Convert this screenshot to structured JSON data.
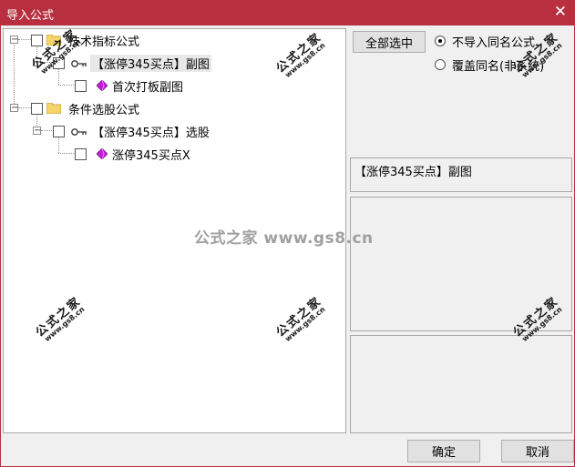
{
  "window": {
    "title": "导入公式"
  },
  "tree": {
    "nodes": [
      {
        "label": "技术指标公式",
        "icon": "folder-icon"
      },
      {
        "label": "【涨停345买点】副图",
        "icon": "key-icon"
      },
      {
        "label": "首次打板副图",
        "icon": "gem-icon"
      },
      {
        "label": "条件选股公式",
        "icon": "folder-icon"
      },
      {
        "label": "【涨停345买点】选股",
        "icon": "key-icon"
      },
      {
        "label": "涨停345买点X",
        "icon": "gem-icon"
      }
    ]
  },
  "actions": {
    "select_all": "全部选中"
  },
  "options": {
    "no_import_same_name": "不导入同名公式",
    "overwrite_same_name": "覆盖同名(非系统)",
    "selected": "no_import_same_name"
  },
  "preview": {
    "text": "【涨停345买点】副图"
  },
  "footer": {
    "ok": "确定",
    "cancel": "取消"
  },
  "watermark": {
    "cn": "公式之家",
    "url": "www.gs8.cn",
    "center": "公式之家 www.gs8.cn"
  },
  "colors": {
    "titlebar": "#b8303f",
    "folder": "#f5d56a",
    "gem": "#c21fd6"
  }
}
